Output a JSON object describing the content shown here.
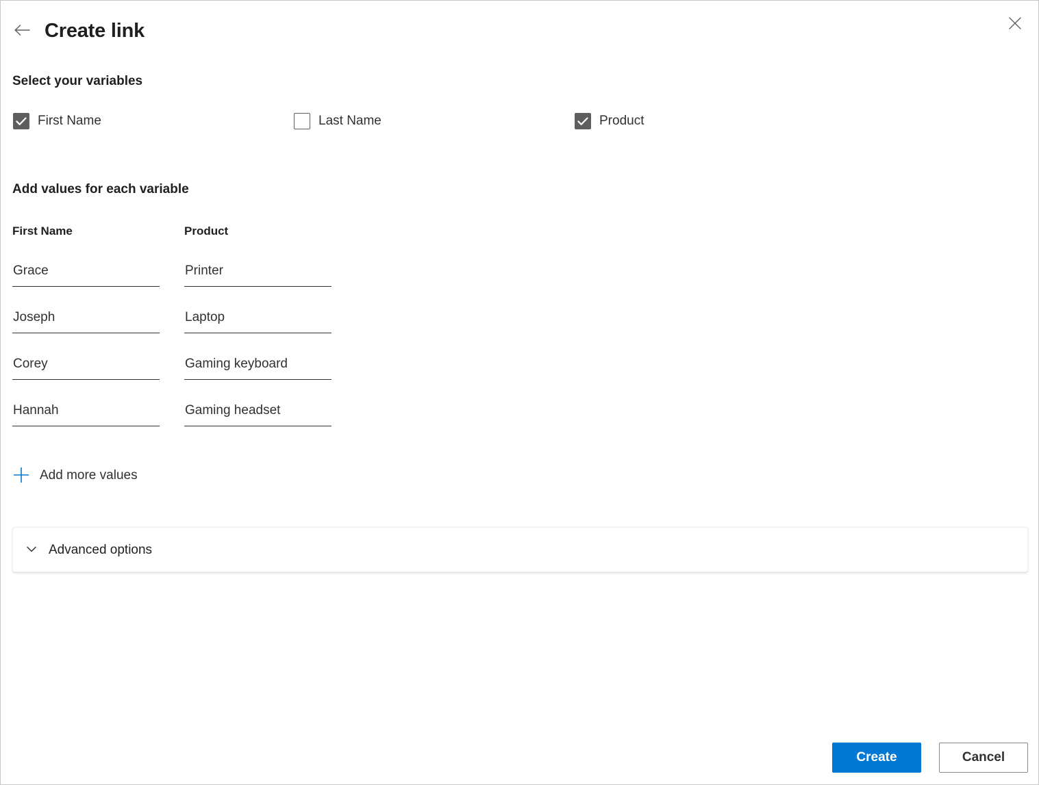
{
  "header": {
    "title": "Create link",
    "back_icon": "arrow-left-icon",
    "close_icon": "close-icon"
  },
  "select_variables": {
    "heading": "Select your variables",
    "items": [
      {
        "label": "First Name",
        "checked": true
      },
      {
        "label": "Last Name",
        "checked": false
      },
      {
        "label": "Product",
        "checked": true
      }
    ]
  },
  "add_values": {
    "heading": "Add values for each variable",
    "columns": [
      {
        "header": "First Name",
        "values": [
          "Grace",
          "Joseph",
          "Corey",
          "Hannah"
        ]
      },
      {
        "header": "Product",
        "values": [
          "Printer",
          "Laptop",
          "Gaming keyboard",
          "Gaming headset"
        ]
      }
    ],
    "add_more_label": "Add more values",
    "add_more_icon": "plus-icon"
  },
  "advanced": {
    "label": "Advanced options",
    "chevron_icon": "chevron-down-icon",
    "expanded": false
  },
  "footer": {
    "create_label": "Create",
    "cancel_label": "Cancel"
  },
  "colors": {
    "accent": "#0078d4",
    "checkbox_checked": "#605e5c",
    "text_primary": "#201f1e",
    "text_secondary": "#323130",
    "border": "#c8c6c4"
  }
}
